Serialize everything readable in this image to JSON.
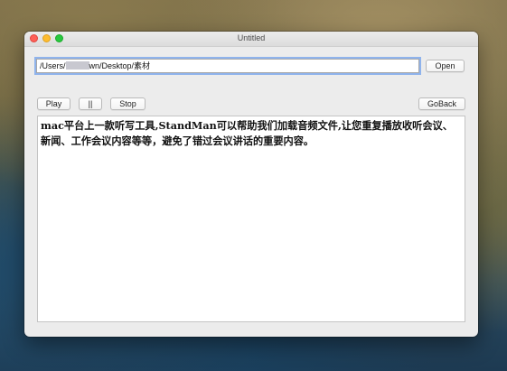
{
  "window": {
    "title": "Untitled"
  },
  "path": {
    "prefix": "/Users/",
    "suffix": "wn/Desktop/素材"
  },
  "buttons": {
    "open": "Open",
    "play": "Play",
    "pause": "||",
    "stop": "Stop",
    "goback": "GoBack"
  },
  "content": {
    "text": "mac平台上一款听写工具,StandMan可以帮助我们加载音频文件,让您重复播放收听会议、新闻、工作会议内容等等，避免了错过会议讲话的重要内容。"
  },
  "colors": {
    "close": "#fe5f57",
    "minimize": "#febc2e",
    "maximize": "#28c840",
    "focus_ring": "#8fb3ec"
  }
}
